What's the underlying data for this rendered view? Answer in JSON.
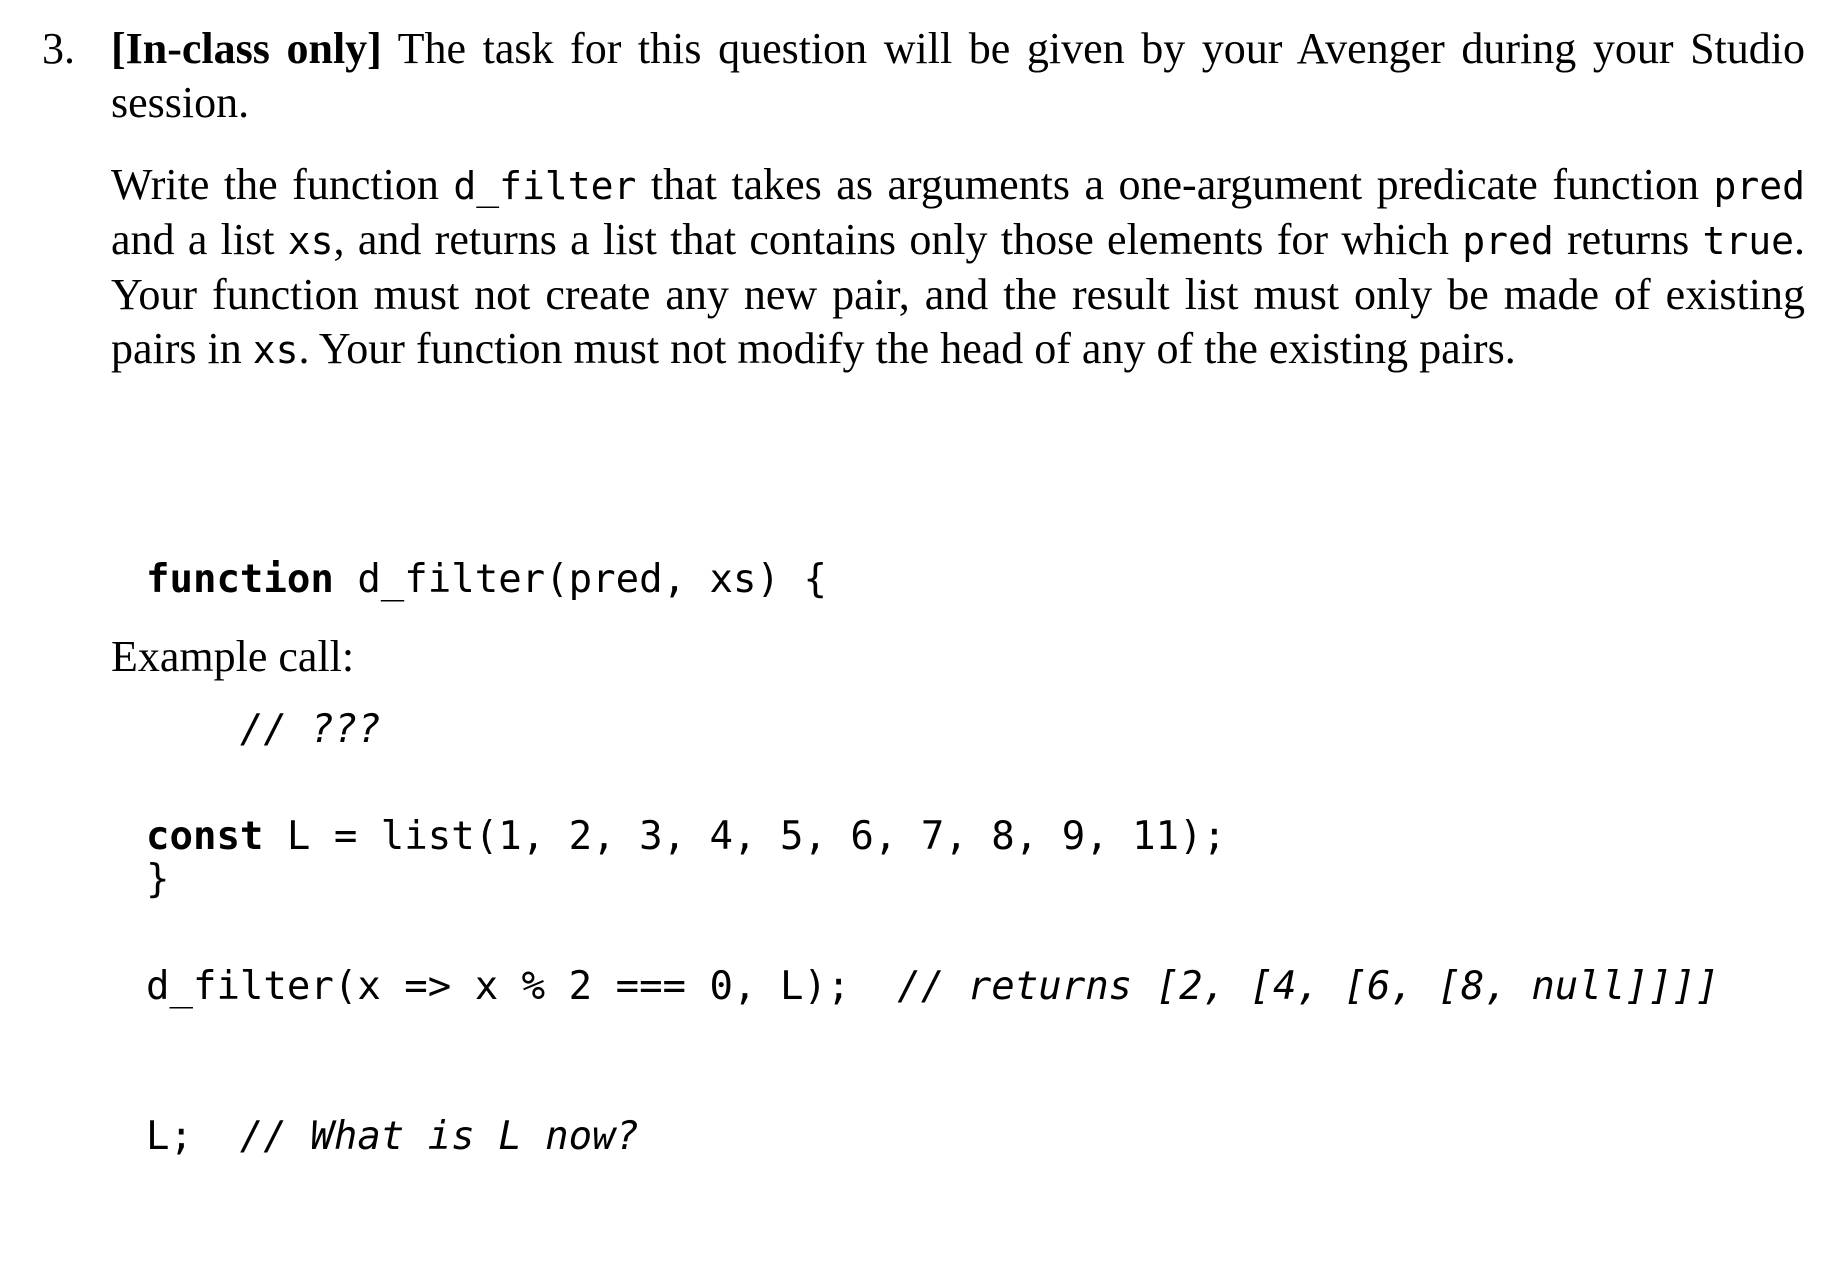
{
  "question": {
    "number": "3.",
    "tag": "[In-class only]",
    "intro": " The task for this question will be given by your Avenger during your Studio session.",
    "description": {
      "t1": "Write the function ",
      "c1": "d_filter",
      "t2": " that takes as arguments a one-argument predicate function ",
      "c2": "pred",
      "t3": " and a list ",
      "c3": "xs",
      "t4": ", and returns a list that contains only those elements for which ",
      "c4": "pred",
      "t5": " returns ",
      "c5": "true",
      "t6": ". Your function must not create any new pair, and the result list must only be made of existing pairs in ",
      "c6": "xs",
      "t7": ". Your function must not modify the head of any of the existing pairs."
    },
    "code_definition": {
      "keyword": "function",
      "signature": " d_filter(pred, xs) {",
      "body_comment": "// ???",
      "closing": "}"
    },
    "example_label": "Example call:",
    "example_code": {
      "line1_keyword": "const",
      "line1_rest": " L = list(1, 2, 3, 4, 5, 6, 7, 8, 9, 11);",
      "line2_code": "d_filter(x => x % 2 === 0, L);  ",
      "line2_comment": "// returns [2, [4, [6, [8, null]]]]",
      "line3_code": "L;  ",
      "line3_comment": "// What is L now?"
    }
  }
}
